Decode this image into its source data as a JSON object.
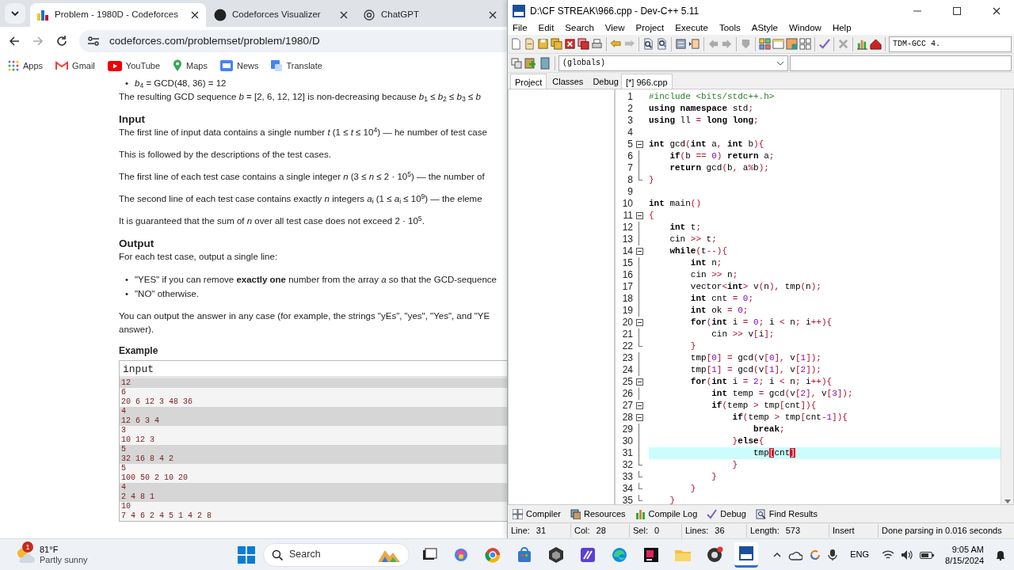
{
  "browser": {
    "tabs": [
      {
        "title": "Problem - 1980D - Codeforces",
        "selected": true
      },
      {
        "title": "Codeforces Visualizer",
        "selected": false
      },
      {
        "title": "ChatGPT",
        "selected": false
      }
    ],
    "address": "codeforces.com/problemset/problem/1980/D",
    "bookmarks": [
      "Apps",
      "Gmail",
      "YouTube",
      "Maps",
      "News",
      "Translate"
    ],
    "problem": {
      "blocks": [
        {
          "kind": "bullet",
          "marker": "•",
          "text": "*b*$_{4}$ = GCD(48, 36) = 12"
        },
        {
          "kind": "para",
          "text": "The resulting GCD sequence *b* = [2, 6, 12, 12] is non-decreasing because *b*$_{1}$ ≤ *b*$_{2}$ ≤ *b*$_{3}$ ≤ *b*"
        },
        {
          "kind": "heading",
          "text": "Input"
        },
        {
          "kind": "para",
          "text": "The first line of input data contains a single number *t* (1 ≤ *t* ≤ 10$^{4}$) — he number of test case"
        },
        {
          "kind": "para",
          "text": "This is followed by the descriptions of the test cases."
        },
        {
          "kind": "para",
          "text": "The first line of each test case contains a single integer *n* (3 ≤ *n* ≤ 2 · 10$^{5}$) — the number of"
        },
        {
          "kind": "para",
          "text": "The second line of each test case contains exactly *n* integers *a*$_{i}$ (1 ≤ *a*$_{i}$ ≤ 10$^{9}$) — the eleme"
        },
        {
          "kind": "para",
          "text": "It is guaranteed that the sum of *n* over all test case does not exceed 2 · 10$^{5}$."
        },
        {
          "kind": "heading",
          "text": "Output"
        },
        {
          "kind": "para",
          "text": "For each test case, output a single line:"
        },
        {
          "kind": "list",
          "items": [
            {
              "marker": "•",
              "text": "\"YES\" if you can remove **exactly one** number from the array *a* so that the GCD-sequence"
            },
            {
              "marker": "•",
              "text": "\"NO\" otherwise."
            }
          ]
        },
        {
          "kind": "lines",
          "lines": [
            "You can output the answer in any case (for example, the strings \"yEs\", \"yes\", \"Yes\", and \"YE",
            "answer)."
          ]
        }
      ],
      "example": {
        "title": "Example",
        "header": "input",
        "lines": [
          {
            "text": "12",
            "shaded": true
          },
          {
            "text": "6",
            "shaded": false
          },
          {
            "text": "20 6 12 3 48 36",
            "shaded": false
          },
          {
            "text": "4",
            "shaded": true
          },
          {
            "text": "12 6 3 4",
            "shaded": true
          },
          {
            "text": "3",
            "shaded": false
          },
          {
            "text": "10 12 3",
            "shaded": false
          },
          {
            "text": "5",
            "shaded": true
          },
          {
            "text": "32 16 8 4 2",
            "shaded": true
          },
          {
            "text": "5",
            "shaded": false
          },
          {
            "text": "100 50 2 10 20",
            "shaded": false
          },
          {
            "text": "4",
            "shaded": true
          },
          {
            "text": "2 4 8 1",
            "shaded": true
          },
          {
            "text": "10",
            "shaded": false
          },
          {
            "text": "7 4 6 2 4 5 1 4 2 8",
            "shaded": false
          }
        ]
      }
    }
  },
  "devcpp": {
    "title": "D:\\CF STREAK\\966.cpp - Dev-C++ 5.11",
    "menu": [
      "File",
      "Edit",
      "Search",
      "View",
      "Project",
      "Execute",
      "Tools",
      "AStyle",
      "Window",
      "Help"
    ],
    "compiler": "TDM-GCC 4.",
    "scope": "(globals)",
    "side_tabs": [
      {
        "label": "Project",
        "selected": true
      },
      {
        "label": "Classes",
        "selected": false
      },
      {
        "label": "Debug",
        "selected": false
      }
    ],
    "editor_tabs": [
      {
        "label": "[*] 966.cpp",
        "selected": true
      }
    ],
    "lines": [
      {
        "n": "1",
        "kind": "plain",
        "current": false,
        "tokens": [
          {
            "kind": "pre",
            "text": "#include <bits/stdc++.h>"
          }
        ]
      },
      {
        "n": "2",
        "kind": "plain",
        "current": false,
        "tokens": [
          {
            "kind": "kw",
            "text": "using"
          },
          {
            "kind": "kw",
            "text": " namespace"
          },
          {
            "kind": "id",
            "text": " std"
          },
          {
            "kind": "sym",
            "text": ";"
          }
        ]
      },
      {
        "n": "3",
        "kind": "plain",
        "current": false,
        "tokens": [
          {
            "kind": "kw",
            "text": "using"
          },
          {
            "kind": "id",
            "text": " ll "
          },
          {
            "kind": "sym",
            "text": "="
          },
          {
            "kind": "kw",
            "text": " long long"
          },
          {
            "kind": "sym",
            "text": ";"
          }
        ]
      },
      {
        "n": "4",
        "kind": "plain",
        "current": false
      },
      {
        "n": "5",
        "kind": "fold-start",
        "current": false,
        "tokens": [
          {
            "kind": "kw",
            "text": "int"
          },
          {
            "kind": "id",
            "text": " gcd"
          },
          {
            "kind": "sym",
            "text": "("
          },
          {
            "kind": "kw",
            "text": "int"
          },
          {
            "kind": "id",
            "text": " a"
          },
          {
            "kind": "sym",
            "text": ", "
          },
          {
            "kind": "kw",
            "text": "int"
          },
          {
            "kind": "id",
            "text": " b"
          },
          {
            "kind": "sym",
            "text": "){"
          }
        ]
      },
      {
        "n": "6",
        "kind": "in-block",
        "current": false,
        "tokens": [
          {
            "kind": "kw",
            "text": "    if"
          },
          {
            "kind": "sym",
            "text": "("
          },
          {
            "kind": "id",
            "text": "b "
          },
          {
            "kind": "sym",
            "text": "=="
          },
          {
            "kind": "num",
            "text": " 0"
          },
          {
            "kind": "sym",
            "text": ")"
          },
          {
            "kind": "kw",
            "text": " return"
          },
          {
            "kind": "id",
            "text": " a"
          },
          {
            "kind": "sym",
            "text": ";"
          }
        ]
      },
      {
        "n": "7",
        "kind": "in-block",
        "current": false,
        "tokens": [
          {
            "kind": "kw",
            "text": "    return"
          },
          {
            "kind": "id",
            "text": " gcd"
          },
          {
            "kind": "sym",
            "text": "("
          },
          {
            "kind": "id",
            "text": "b"
          },
          {
            "kind": "sym",
            "text": ", "
          },
          {
            "kind": "id",
            "text": "a"
          },
          {
            "kind": "sym",
            "text": "%"
          },
          {
            "kind": "id",
            "text": "b"
          },
          {
            "kind": "sym",
            "text": ");"
          }
        ]
      },
      {
        "n": "8",
        "kind": "fold-end",
        "current": false,
        "tokens": [
          {
            "kind": "sym",
            "text": "}"
          }
        ]
      },
      {
        "n": "9",
        "kind": "plain",
        "current": false
      },
      {
        "n": "10",
        "kind": "plain",
        "current": false,
        "tokens": [
          {
            "kind": "kw",
            "text": "int"
          },
          {
            "kind": "id",
            "text": " main"
          },
          {
            "kind": "sym",
            "text": "()"
          }
        ]
      },
      {
        "n": "11",
        "kind": "fold-start",
        "current": false,
        "tokens": [
          {
            "kind": "sym",
            "text": "{"
          }
        ]
      },
      {
        "n": "12",
        "kind": "in-block",
        "current": false,
        "tokens": [
          {
            "kind": "kw",
            "text": "    int"
          },
          {
            "kind": "id",
            "text": " t"
          },
          {
            "kind": "sym",
            "text": ";"
          }
        ]
      },
      {
        "n": "13",
        "kind": "in-block",
        "current": false,
        "tokens": [
          {
            "kind": "id",
            "text": "    cin "
          },
          {
            "kind": "sym",
            "text": ">>"
          },
          {
            "kind": "id",
            "text": " t"
          },
          {
            "kind": "sym",
            "text": ";"
          }
        ]
      },
      {
        "n": "14",
        "kind": "fold-start",
        "current": false,
        "tokens": [
          {
            "kind": "kw",
            "text": "    while"
          },
          {
            "kind": "sym",
            "text": "("
          },
          {
            "kind": "id",
            "text": "t"
          },
          {
            "kind": "sym",
            "text": "--){"
          }
        ]
      },
      {
        "n": "15",
        "kind": "in-block",
        "current": false,
        "tokens": [
          {
            "kind": "kw",
            "text": "        int"
          },
          {
            "kind": "id",
            "text": " n"
          },
          {
            "kind": "sym",
            "text": ";"
          }
        ]
      },
      {
        "n": "16",
        "kind": "in-block",
        "current": false,
        "tokens": [
          {
            "kind": "id",
            "text": "        cin "
          },
          {
            "kind": "sym",
            "text": ">>"
          },
          {
            "kind": "id",
            "text": " n"
          },
          {
            "kind": "sym",
            "text": ";"
          }
        ]
      },
      {
        "n": "17",
        "kind": "in-block",
        "current": false,
        "tokens": [
          {
            "kind": "id",
            "text": "        vector"
          },
          {
            "kind": "sym",
            "text": "<"
          },
          {
            "kind": "kw",
            "text": "int"
          },
          {
            "kind": "sym",
            "text": ">"
          },
          {
            "kind": "id",
            "text": " v"
          },
          {
            "kind": "sym",
            "text": "("
          },
          {
            "kind": "id",
            "text": "n"
          },
          {
            "kind": "sym",
            "text": "), "
          },
          {
            "kind": "id",
            "text": "tmp"
          },
          {
            "kind": "sym",
            "text": "("
          },
          {
            "kind": "id",
            "text": "n"
          },
          {
            "kind": "sym",
            "text": ");"
          }
        ]
      },
      {
        "n": "18",
        "kind": "in-block",
        "current": false,
        "tokens": [
          {
            "kind": "kw",
            "text": "        int"
          },
          {
            "kind": "id",
            "text": " cnt "
          },
          {
            "kind": "sym",
            "text": "="
          },
          {
            "kind": "num",
            "text": " 0"
          },
          {
            "kind": "sym",
            "text": ";"
          }
        ]
      },
      {
        "n": "19",
        "kind": "in-block",
        "current": false,
        "tokens": [
          {
            "kind": "kw",
            "text": "        int"
          },
          {
            "kind": "id",
            "text": " ok "
          },
          {
            "kind": "sym",
            "text": "="
          },
          {
            "kind": "num",
            "text": " 0"
          },
          {
            "kind": "sym",
            "text": ";"
          }
        ]
      },
      {
        "n": "20",
        "kind": "fold-start",
        "current": false,
        "tokens": [
          {
            "kind": "kw",
            "text": "        for"
          },
          {
            "kind": "sym",
            "text": "("
          },
          {
            "kind": "kw",
            "text": "int"
          },
          {
            "kind": "id",
            "text": " i "
          },
          {
            "kind": "sym",
            "text": "="
          },
          {
            "kind": "num",
            "text": " 0"
          },
          {
            "kind": "sym",
            "text": ";"
          },
          {
            "kind": "id",
            "text": " i "
          },
          {
            "kind": "sym",
            "text": "<"
          },
          {
            "kind": "id",
            "text": " n"
          },
          {
            "kind": "sym",
            "text": ";"
          },
          {
            "kind": "id",
            "text": " i"
          },
          {
            "kind": "sym",
            "text": "++){"
          }
        ]
      },
      {
        "n": "21",
        "kind": "in-block",
        "current": false,
        "tokens": [
          {
            "kind": "id",
            "text": "            cin "
          },
          {
            "kind": "sym",
            "text": ">>"
          },
          {
            "kind": "id",
            "text": " v"
          },
          {
            "kind": "sym",
            "text": "["
          },
          {
            "kind": "id",
            "text": "i"
          },
          {
            "kind": "sym",
            "text": "];"
          }
        ]
      },
      {
        "n": "22",
        "kind": "fold-end",
        "current": false,
        "tokens": [
          {
            "kind": "sym",
            "text": "        }"
          }
        ]
      },
      {
        "n": "23",
        "kind": "in-block",
        "current": false,
        "tokens": [
          {
            "kind": "id",
            "text": "        tmp"
          },
          {
            "kind": "sym",
            "text": "["
          },
          {
            "kind": "num",
            "text": "0"
          },
          {
            "kind": "sym",
            "text": "] = "
          },
          {
            "kind": "id",
            "text": "gcd"
          },
          {
            "kind": "sym",
            "text": "("
          },
          {
            "kind": "id",
            "text": "v"
          },
          {
            "kind": "sym",
            "text": "["
          },
          {
            "kind": "num",
            "text": "0"
          },
          {
            "kind": "sym",
            "text": "], "
          },
          {
            "kind": "id",
            "text": "v"
          },
          {
            "kind": "sym",
            "text": "["
          },
          {
            "kind": "num",
            "text": "1"
          },
          {
            "kind": "sym",
            "text": "]);"
          }
        ]
      },
      {
        "n": "24",
        "kind": "in-block",
        "current": false,
        "tokens": [
          {
            "kind": "id",
            "text": "        tmp"
          },
          {
            "kind": "sym",
            "text": "["
          },
          {
            "kind": "num",
            "text": "1"
          },
          {
            "kind": "sym",
            "text": "] = "
          },
          {
            "kind": "id",
            "text": "gcd"
          },
          {
            "kind": "sym",
            "text": "("
          },
          {
            "kind": "id",
            "text": "v"
          },
          {
            "kind": "sym",
            "text": "["
          },
          {
            "kind": "num",
            "text": "1"
          },
          {
            "kind": "sym",
            "text": "], "
          },
          {
            "kind": "id",
            "text": "v"
          },
          {
            "kind": "sym",
            "text": "["
          },
          {
            "kind": "num",
            "text": "2"
          },
          {
            "kind": "sym",
            "text": "]);"
          }
        ]
      },
      {
        "n": "25",
        "kind": "fold-start",
        "current": false,
        "tokens": [
          {
            "kind": "kw",
            "text": "        for"
          },
          {
            "kind": "sym",
            "text": "("
          },
          {
            "kind": "kw",
            "text": "int"
          },
          {
            "kind": "id",
            "text": " i "
          },
          {
            "kind": "sym",
            "text": "="
          },
          {
            "kind": "num",
            "text": " 2"
          },
          {
            "kind": "sym",
            "text": ";"
          },
          {
            "kind": "id",
            "text": " i "
          },
          {
            "kind": "sym",
            "text": "<"
          },
          {
            "kind": "id",
            "text": " n"
          },
          {
            "kind": "sym",
            "text": ";"
          },
          {
            "kind": "id",
            "text": " i"
          },
          {
            "kind": "sym",
            "text": "++){"
          }
        ]
      },
      {
        "n": "26",
        "kind": "in-block",
        "current": false,
        "tokens": [
          {
            "kind": "kw",
            "text": "            int"
          },
          {
            "kind": "id",
            "text": " temp "
          },
          {
            "kind": "sym",
            "text": "="
          },
          {
            "kind": "id",
            "text": " gcd"
          },
          {
            "kind": "sym",
            "text": "("
          },
          {
            "kind": "id",
            "text": "v"
          },
          {
            "kind": "sym",
            "text": "["
          },
          {
            "kind": "num",
            "text": "2"
          },
          {
            "kind": "sym",
            "text": "], "
          },
          {
            "kind": "id",
            "text": "v"
          },
          {
            "kind": "sym",
            "text": "["
          },
          {
            "kind": "num",
            "text": "3"
          },
          {
            "kind": "sym",
            "text": "]);"
          }
        ]
      },
      {
        "n": "27",
        "kind": "fold-start",
        "current": false,
        "tokens": [
          {
            "kind": "kw",
            "text": "            if"
          },
          {
            "kind": "sym",
            "text": "("
          },
          {
            "kind": "id",
            "text": "temp "
          },
          {
            "kind": "sym",
            "text": ">"
          },
          {
            "kind": "id",
            "text": " tmp"
          },
          {
            "kind": "sym",
            "text": "["
          },
          {
            "kind": "id",
            "text": "cnt"
          },
          {
            "kind": "sym",
            "text": "]){"
          }
        ]
      },
      {
        "n": "28",
        "kind": "fold-start",
        "current": false,
        "tokens": [
          {
            "kind": "kw",
            "text": "                if"
          },
          {
            "kind": "sym",
            "text": "("
          },
          {
            "kind": "id",
            "text": "temp "
          },
          {
            "kind": "sym",
            "text": ">"
          },
          {
            "kind": "id",
            "text": " tmp"
          },
          {
            "kind": "sym",
            "text": "["
          },
          {
            "kind": "id",
            "text": "cnt"
          },
          {
            "kind": "sym",
            "text": "-"
          },
          {
            "kind": "num",
            "text": "1"
          },
          {
            "kind": "sym",
            "text": "]){"
          }
        ]
      },
      {
        "n": "29",
        "kind": "in-block",
        "current": false,
        "tokens": [
          {
            "kind": "kw",
            "text": "                    break"
          },
          {
            "kind": "sym",
            "text": ";"
          }
        ]
      },
      {
        "n": "30",
        "kind": "in-block",
        "current": false,
        "tokens": [
          {
            "kind": "sym",
            "text": "                }"
          },
          {
            "kind": "kw",
            "text": "else"
          },
          {
            "kind": "sym",
            "text": "{"
          }
        ]
      },
      {
        "n": "31",
        "kind": "in-block",
        "current": true,
        "tokens": [
          {
            "kind": "id",
            "text": "                    tmp"
          },
          {
            "kind": "match",
            "text": "["
          },
          {
            "kind": "id",
            "text": "cnt"
          },
          {
            "kind": "match",
            "text": "]"
          }
        ]
      },
      {
        "n": "32",
        "kind": "fold-end",
        "current": false,
        "tokens": [
          {
            "kind": "sym",
            "text": "                }"
          }
        ]
      },
      {
        "n": "33",
        "kind": "fold-end",
        "current": false,
        "tokens": [
          {
            "kind": "sym",
            "text": "            }"
          }
        ]
      },
      {
        "n": "34",
        "kind": "fold-end",
        "current": false,
        "tokens": [
          {
            "kind": "sym",
            "text": "        }"
          }
        ]
      },
      {
        "n": "35",
        "kind": "fold-end",
        "current": false,
        "tokens": [
          {
            "kind": "sym",
            "text": "    }"
          }
        ]
      }
    ],
    "bottom_tabs": [
      "Compiler",
      "Resources",
      "Compile Log",
      "Debug",
      "Find Results"
    ],
    "status": [
      {
        "label": "Line:",
        "value": "31"
      },
      {
        "label": "Col:",
        "value": "28"
      },
      {
        "label": "Sel:",
        "value": "0"
      },
      {
        "label": "Lines:",
        "value": "36"
      },
      {
        "label": "Length:",
        "value": "573"
      }
    ],
    "mode": "Insert",
    "message": "Done parsing in 0.016 seconds"
  },
  "taskbar": {
    "weather": {
      "badge": "1",
      "temperature": "81°F",
      "condition": "Partly sunny"
    },
    "search": {
      "placeholder": "Search"
    },
    "apps": [
      {
        "active": false
      },
      {
        "active": false
      },
      {
        "active": false
      },
      {
        "active": false
      },
      {
        "active": false
      },
      {
        "active": false
      },
      {
        "active": false
      },
      {
        "active": false
      },
      {
        "active": false
      },
      {
        "active": false
      },
      {
        "active": true
      }
    ],
    "language": "ENG",
    "time": "9:05 AM",
    "date": "8/15/2024"
  }
}
